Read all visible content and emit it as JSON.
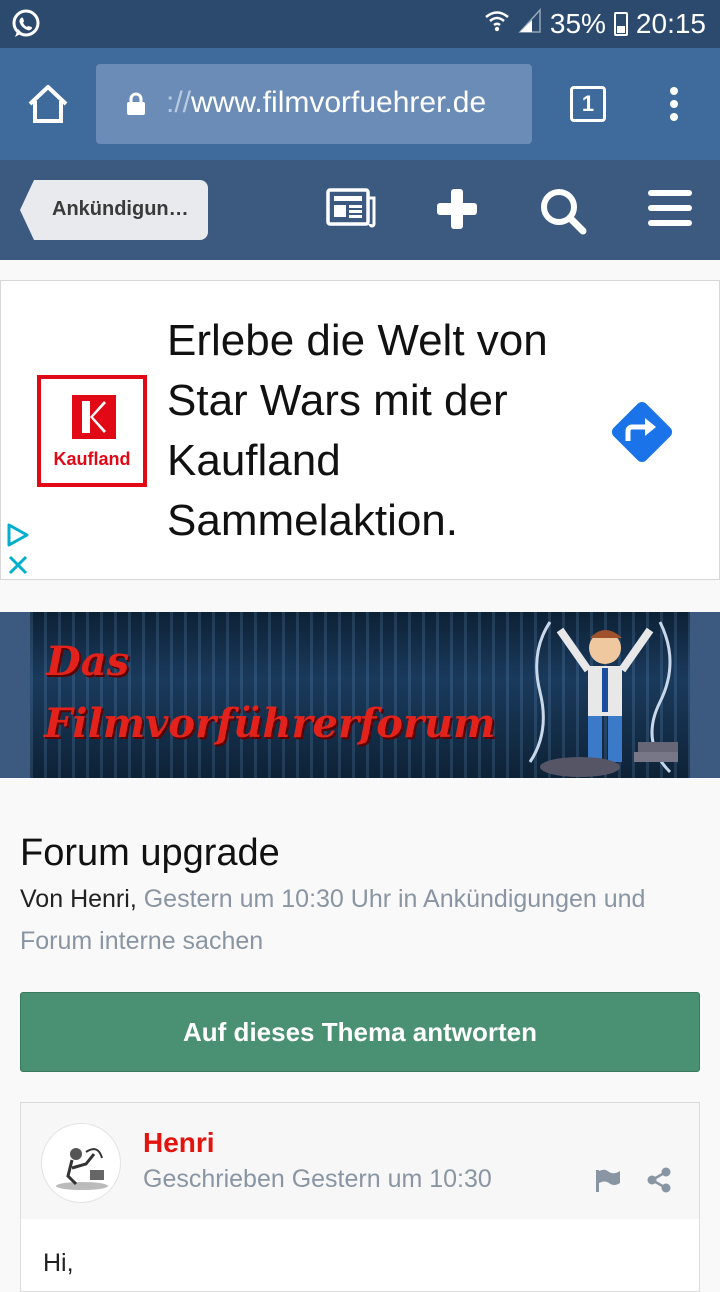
{
  "status": {
    "battery": "35%",
    "time": "20:15",
    "icons": [
      "whatsapp-icon",
      "wifi-icon",
      "signal-icon",
      "battery-icon"
    ]
  },
  "browser": {
    "url_prefix": "://",
    "url_host": "www.filmvorfuehrer.de",
    "tab_count": "1"
  },
  "nav": {
    "breadcrumb": "Ankündigun…",
    "icons": [
      "newspaper-icon",
      "plus-icon",
      "search-icon",
      "hamburger-icon"
    ]
  },
  "ad": {
    "brand": "Kaufland",
    "headline": "Erlebe die Welt von Star Wars mit der Kaufland Sammelaktion.",
    "brand_color": "#e10915",
    "arrow_color": "#1a73e8"
  },
  "banner": {
    "line1": "Das",
    "line2": "Filmvorführerforum"
  },
  "topic": {
    "title": "Forum upgrade",
    "by_label": "Von",
    "author": "Henri",
    "meta_rest": "Gestern um 10:30 Uhr in Ankündigungen und Forum interne sachen",
    "reply_button": "Auf dieses Thema antworten",
    "reply_color": "#4a9072"
  },
  "post": {
    "author": "Henri",
    "date": "Geschrieben Gestern um 10:30",
    "body_start": "Hi,",
    "author_color": "#e3130e"
  }
}
